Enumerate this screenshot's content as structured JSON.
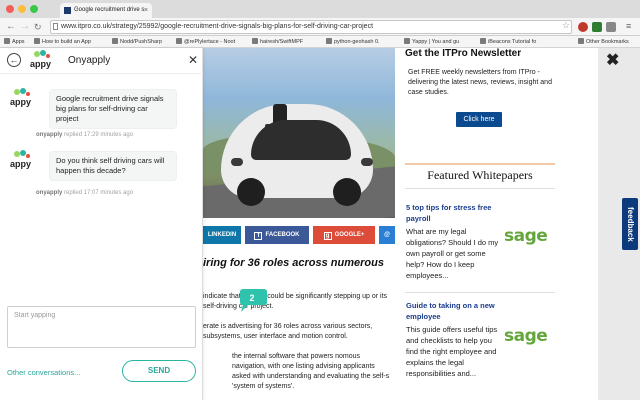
{
  "browser": {
    "tab_title": "Google recruitment drive s",
    "tab_close": "×",
    "user": "",
    "url": "www.itpro.co.uk/strategy/25992/google-recruitment-drive-signals-big-plans-for-self-driving-car-project",
    "bookmarks": [
      {
        "label": "Apps"
      },
      {
        "label": "How to build an App"
      },
      {
        "label": "Nodd/PushSharp"
      },
      {
        "label": "@rePlylertace - Noot"
      },
      {
        "label": "hairesh/SwiftMPF"
      },
      {
        "label": "python-geohash 0."
      },
      {
        "label": "Yappy | You and gu"
      },
      {
        "label": "iBeacons Tutorial fo"
      },
      {
        "label": "Other Bookmarks"
      }
    ]
  },
  "panel": {
    "title": "Onyapply",
    "logo_text": "appy",
    "messages": [
      {
        "text": "Google recruitment drive signals big plans for self-driving car project",
        "author": "onyapply",
        "meta": "replied 17:29 minutes ago"
      },
      {
        "text": "Do you think self driving cars will happen this decade?",
        "author": "onyapply",
        "meta": "replied 17:07 minutes ago"
      }
    ],
    "composer_placeholder": "Start yapping",
    "other_conversations": "Other conversations...",
    "send_label": "SEND",
    "unread_count": "2"
  },
  "article": {
    "share": {
      "linkedin": "LINKEDIN",
      "facebook": "FACEBOOK",
      "google": "GOOGLE+",
      "email": "@"
    },
    "title": "iring for 36 roles across numerous",
    "para1": "indicate that Google could be significantly stepping up or its self-driving car project.",
    "para2": "erate is advertising for 36 roles across various sectors, subsystems, user interface and motion control.",
    "para3": "the internal software that powers nomous navigation, with one listing advising applicants asked with understanding and evaluating the self-s 'system of systems'."
  },
  "sidebar": {
    "newsletter_title": "Get the ITPro Newsletter",
    "newsletter_text": "Get FREE weekly newsletters from ITPro - delivering the latest news, reviews, insight and case studies.",
    "click_here": "Click here",
    "whitepapers_title": "Featured Whitepapers",
    "whitepapers": [
      {
        "title": "5 top tips for stress free payroll",
        "desc": "What are my legal obligations? Should I do my own payroll or get some help? How do I keep employees...",
        "logo": "sage"
      },
      {
        "title": "Guide to taking on a new employee",
        "desc": "This guide offers useful tips and checklists to help you find the right employee and explains the legal responsibilities and...",
        "logo": "sage"
      }
    ],
    "feedback": "feedback",
    "close": "✖"
  },
  "colors": {
    "accent": "#2aa59a",
    "link": "#1a3c8c",
    "button": "#0b4a8f",
    "sage": "#64a63c"
  }
}
